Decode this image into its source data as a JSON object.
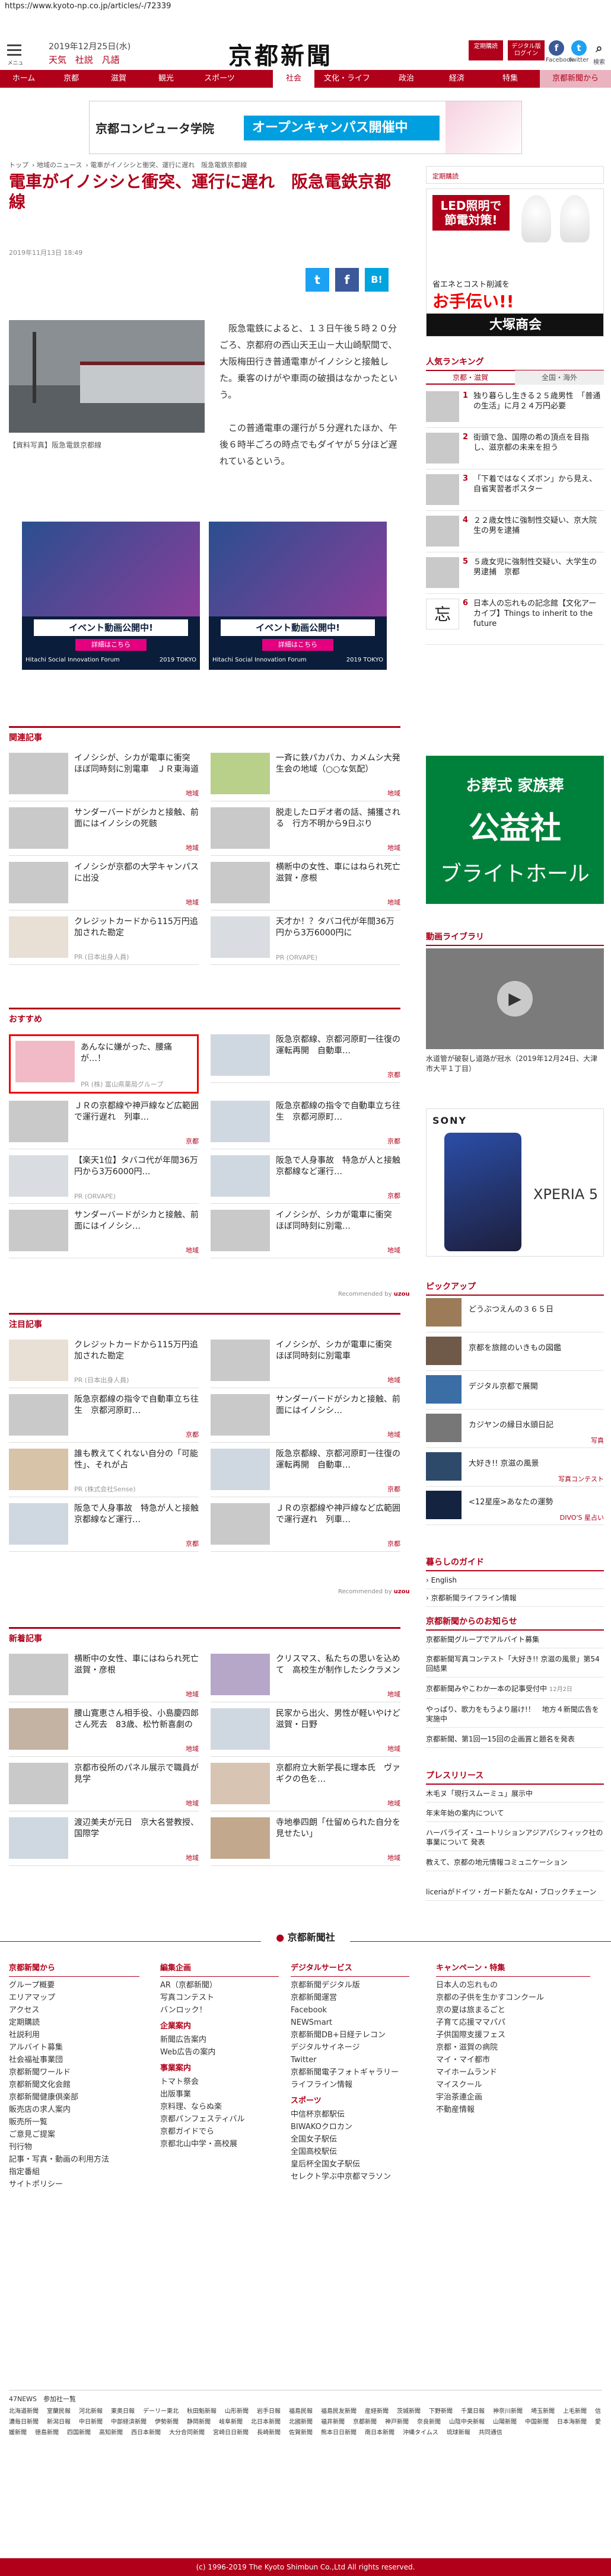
{
  "url": "https://www.kyoto-np.co.jp/articles/-/72339",
  "header": {
    "menu_label": "メニュー",
    "date": "2019年12月25日(水)",
    "weather": [
      "天気",
      "社説",
      "凡語"
    ],
    "logo": "京都新聞",
    "btn_member": "定期購読",
    "btn_digital": "デジタル版 ログイン",
    "social": [
      "Facebook",
      "twitter",
      "検索"
    ]
  },
  "nav": [
    "ホーム",
    "京都",
    "滋賀",
    "観光",
    "スポーツ",
    "社会",
    "文化・ライフ",
    "政治",
    "経済",
    "特集",
    "京都新聞から"
  ],
  "banner": {
    "school": "京都コンピュータ学院",
    "text": "オープンキャンパス開催中"
  },
  "breadcrumb": [
    "トップ",
    "地域のニュース",
    "電車がイノシシと衝突、運行に遅れ　阪急電鉄京都線"
  ],
  "article": {
    "title": "電車がイノシシと衝突、運行に遅れ　阪急電鉄京都線",
    "datetime": "2019年11月13日 18:49",
    "share": [
      "t",
      "f",
      "B!"
    ],
    "caption": "【資料写真】阪急電鉄京都線",
    "body1": "阪急電鉄によると、１３日午後５時２０分ごろ、京都府の西山天王山－大山崎駅間で、大阪梅田行き普通電車がイノシシと接触した。乗客のけがや車両の破損はなかったという。",
    "body2": "この普通電車の運行が５分遅れたほか、午後６時半ごろの時点でもダイヤが５分ほど遅れているという。"
  },
  "ads": {
    "headline": "イベント動画公開中!",
    "sub": "詳細はこちら",
    "brand": "Hitachi Social Innovation Forum",
    "year": "2019 TOKYO"
  },
  "related": {
    "heading": "関連記事",
    "items": [
      {
        "title": "イノシシが、シカが電車に衝突　ほぼ同時刻に別電車　ＪＲ東海道",
        "cat": "地域"
      },
      {
        "title": "一斉に鉄パカパカ、カメムシ大発生会の地域（○○な気配）",
        "cat": "地域"
      },
      {
        "title": "サンダーバードがシカと接触、前面にはイノシシの死骸",
        "cat": "地域"
      },
      {
        "title": "脱走したロデオ者の話、捕獲される　行方不明から9日ぶり",
        "cat": "地域"
      },
      {
        "title": "イノシシが京都の大学キャンパスに出没",
        "cat": "地域"
      },
      {
        "title": "横断中の女性、車にはねられ死亡　滋賀・彦根",
        "cat": "地域"
      },
      {
        "title": "クレジットカードから115万円追加された勘定",
        "src": "PR (日本出身人員)"
      },
      {
        "title": "天才か！？タバコ代が年間36万円から3万6000円に",
        "src": "PR (ORVAPE)"
      }
    ]
  },
  "recommend": {
    "heading": "おすすめ",
    "items": [
      {
        "title": "あんなに嫌がった、腰痛が…！",
        "src": "PR (株) 富山県薬局グループ"
      },
      {
        "title": "阪急京都線、京都河原町一往復の運転再開　自動車…",
        "cat": "京都"
      },
      {
        "title": "ＪＲの京都線や神戸線など広範囲で運行遅れ　列車…",
        "cat": "京都"
      },
      {
        "title": "阪急京都線の指令で自動車立ち往生　京都河原町…",
        "cat": "京都"
      },
      {
        "title": "【楽天1位】タバコ代が年間36万円から3万6000円…",
        "src": "PR (ORVAPE)"
      },
      {
        "title": "阪急で人身事故　特急が人と接触　京都線など運行…",
        "cat": "京都"
      },
      {
        "title": "サンダーバードがシカと接触、前面にはイノシシ…",
        "cat": "地域"
      },
      {
        "title": "イノシシが、シカが電車に衝突　ほぼ同時刻に別電…",
        "cat": "地域"
      }
    ],
    "recommended_by": "Recommended by"
  },
  "notable": {
    "heading": "注目記事",
    "items": [
      {
        "title": "クレジットカードから115万円追加された勘定",
        "src": "PR (日本出身人員)"
      },
      {
        "title": "イノシシが、シカが電車に衝突　ほぼ同時刻に別電車",
        "cat": "地域"
      },
      {
        "title": "阪急京都線の指令で自動車立ち往生　京都河原町…",
        "cat": "京都"
      },
      {
        "title": "サンダーバードがシカと接触、前面にはイノシシ…",
        "cat": "地域"
      },
      {
        "title": "誰も教えてくれない自分の「可能性」、それが占",
        "src": "PR (株式会社Sense)"
      },
      {
        "title": "阪急京都線、京都河原町一往復の運転再開　自動車…",
        "cat": "京都"
      },
      {
        "title": "阪急で人身事故　特急が人と接触　京都線など運行…",
        "cat": "京都"
      },
      {
        "title": "ＪＲの京都線や神戸線など広範囲で運行遅れ　列車…",
        "cat": "京都"
      }
    ]
  },
  "newest": {
    "heading": "新着記事",
    "items": [
      {
        "title": "横断中の女性、車にはねられ死亡　滋賀・彦根",
        "cat": "地域"
      },
      {
        "title": "クリスマス、私たちの思いを込めて　高校生が制作したシクラメン",
        "cat": "地域"
      },
      {
        "title": "腰山寛恵さん相手役、小島慶四郎さん死去　83歳、松竹新喜劇の",
        "cat": "地域"
      },
      {
        "title": "民家から出火、男性が軽いやけど　滋賀・日野",
        "cat": "地域"
      },
      {
        "title": "京都市役所のパネル展示で職員が見学",
        "cat": "地域"
      },
      {
        "title": "京都府立大新学長に理本氏　ヴァギクの色を…",
        "cat": "地域"
      },
      {
        "title": "渡辺美夫が元日　京大名誉教授、国際学",
        "cat": "地域"
      },
      {
        "title": "寺地拳四朗「仕留められた自分を見せたい」",
        "cat": "地域"
      }
    ]
  },
  "side": {
    "ad_top": {
      "line1": "LED照明で",
      "line2": "節電対策!",
      "line3": "省エネとコスト削減を",
      "line4": "お手伝い!!",
      "company": "大塚商会"
    },
    "ranking_heading": "人気ランキング",
    "ranking_tabs": [
      "京都・滋賀",
      "全国・海外"
    ],
    "ranking": [
      {
        "num": "1",
        "title": "独り暮らし生きる２５歳男性　「普通の生活」に月２４万円必要"
      },
      {
        "num": "2",
        "title": "街頭で急、国際の希の頂点を目指し、滋京都の未来を担う"
      },
      {
        "num": "3",
        "title": "「下着ではなくズボン」から見え、自省実習者ポスター"
      },
      {
        "num": "4",
        "title": "２２歳女性に強制性交疑い、京大院生の男を逮捕"
      },
      {
        "num": "5",
        "title": "５歳女児に強制性交疑い、大学生の男逮捕　京都"
      },
      {
        "num": "6",
        "title": "日本人の忘れもの記念館【文化アーカイブ】Things to inherit to the future"
      }
    ],
    "ad_funeral": {
      "line1": "お葬式 家族葬",
      "line2": "公益社",
      "line3": "ブライトホール"
    },
    "video_heading": "動画ライブラリ",
    "video_caption": "水道管が破裂し道路が冠水（2019年12月24日、大津市大平１丁目）",
    "ad_sony": {
      "brand": "SONY",
      "model": "XPERIA 5"
    },
    "pickup_heading": "ピックアップ",
    "pickup": [
      {
        "title": "どうぶつえんの３６５日",
        "cat": ""
      },
      {
        "title": "京都を旅館のいきもの図鑑",
        "cat": ""
      },
      {
        "title": "デジタル京都で展開",
        "cat": ""
      },
      {
        "title": "カジヤンの縁日水頭日記",
        "cat": "写真"
      },
      {
        "title": "大好き!! 京滋の風景",
        "cat": "写真コンテスト"
      },
      {
        "title": "<12星座>あなたの運勢",
        "cat": "DIVO'S 星占い"
      }
    ],
    "guide_heading": "暮らしのガイド",
    "guide": [
      "English",
      "京都新聞ライフライン情報"
    ],
    "notice_heading": "京都新聞からのお知らせ",
    "notices": [
      {
        "title": "京都新聞グループでアルバイト募集",
        "date": ""
      },
      {
        "title": "京都新聞写真コンテスト「大好き!! 京滋の風景」第54回結果",
        "date": ""
      },
      {
        "title": "京都新聞みやこわか一本の記事受付中",
        "date": "12月2日"
      },
      {
        "title": "やっぱり、歌力をもうより届け!！　地方４新聞広告を実施中",
        "date": ""
      },
      {
        "title": "京都新聞、第1回一15回の企画賞と題名を発表",
        "date": ""
      }
    ],
    "press_heading": "プレスリリース",
    "press": [
      "木毛ヌ「現行スムーミュ」展示中",
      "年末年始の案内について",
      "ハーバライズ・ユートリションアジアパシフィック社の事業について 発表",
      "教えて、京都の地元情報コミュニケーション",
      "liceriaがドイツ・ガード新たなAI・ブロックチェーン"
    ]
  },
  "footer": {
    "logo": "京都新聞社",
    "cols": [
      {
        "head": "京都新聞から",
        "items": [
          "グループ概要",
          "エリアマップ",
          "アクセス",
          "定期購読",
          "社説利用",
          "アルバイト募集",
          "社会福祉事業団",
          "京都新聞ワールド",
          "京都新聞文化会館",
          "京都新聞健康倶楽部",
          "販売店の求人案内",
          "販売所一覧",
          "ご意見ご提案",
          "刊行物",
          "記事・写真・動画の利用方法",
          "指定番組",
          "サイトポリシー"
        ]
      },
      {
        "head": "編集企画",
        "items": [
          "AR（京都新聞）",
          "写真コンテスト",
          "バンロック！"
        ],
        "sub": [
          [
            "企業案内",
            [
              "新聞広告案内",
              "Web広告の案内"
            ]
          ],
          [
            "事業案内",
            [
              "トマト祭会",
              "出版事業",
              "京料理、ならぬ楽",
              "京都パンフェスティバル",
              "京都ガイドでら",
              "京都北山中学・高校展"
            ]
          ]
        ]
      },
      {
        "head": "デジタルサービス",
        "items": [
          "京都新聞デジタル版",
          "京都新聞運営",
          "Facebook",
          "NEWSmart",
          "京都新聞DB+日経テレコン",
          "デジタルサイネージ",
          "Twitter",
          "京都新聞電子フォトギャラリー",
          "ライフライン情報"
        ],
        "sub": [
          [
            "スポーツ",
            [
              "中信杯京都駅伝",
              "BIWAKOクロカン",
              "全国女子駅伝",
              "全国高校駅伝",
              "皇后杯全国女子駅伝",
              "セレクト学ぶ中京都マラソン"
            ]
          ]
        ]
      },
      {
        "head": "キャンペーン・特集",
        "items": [
          "日本人の忘れもの",
          "京都の子供を生かすコンクール",
          "京の夏は旅まるごと",
          "子育て応援ママパパ",
          "子供国際支援フェス",
          "京都・滋賀の病院",
          "マイ・マイ都市",
          "マイホームランド",
          "マイスクール",
          "宇治茶連企画",
          "不動産情報"
        ]
      }
    ],
    "net_label": "47NEWS　参加社一覧",
    "net": [
      "北海道新聞",
      "室蘭民報",
      "河北新報",
      "東奥日報",
      "デーリー東北",
      "秋田魁新報",
      "山形新聞",
      "岩手日報",
      "福島民報",
      "福島民友新聞",
      "産経新聞",
      "茨城新聞",
      "下野新聞",
      "千葉日報",
      "神奈川新聞",
      "埼玉新聞",
      "上毛新聞",
      "信濃毎日新聞",
      "新潟日報",
      "中日新聞",
      "中部経済新聞",
      "伊勢新聞",
      "静岡新聞",
      "岐阜新聞",
      "北日本新聞",
      "北國新聞",
      "福井新聞",
      "京都新聞",
      "神戸新聞",
      "奈良新聞",
      "山陰中央新報",
      "山陽新聞",
      "中国新聞",
      "日本海新聞",
      "愛媛新聞",
      "徳島新聞",
      "四国新聞",
      "高知新聞",
      "西日本新聞",
      "大分合同新聞",
      "宮崎日日新聞",
      "長崎新聞",
      "佐賀新聞",
      "熊本日日新聞",
      "南日本新聞",
      "沖縄タイムス",
      "琉球新報",
      "共同通信"
    ],
    "copyright": "(c) 1996-2019 The Kyoto Shimbun Co.,Ltd All rights reserved."
  },
  "colors": {
    "brand": "#b0001a"
  }
}
